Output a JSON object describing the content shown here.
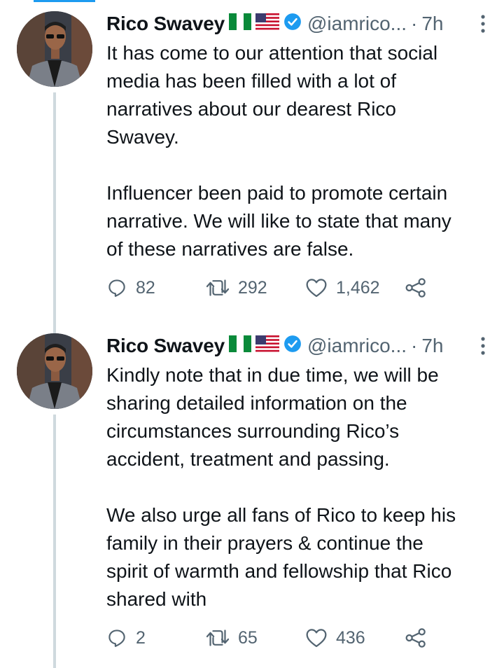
{
  "colors": {
    "accent": "#1d9bf0",
    "secondary_text": "#536471",
    "thread_line": "#cfd9de"
  },
  "tweets": [
    {
      "author_name": "Rico Swavey",
      "flags": [
        "nigeria-flag-icon",
        "usa-flag-icon"
      ],
      "verified": true,
      "handle": "@iamrico...",
      "separator": "·",
      "time": "7h",
      "paragraphs": [
        [
          "It has come to our attention that social",
          "media has been filled with a lot of",
          "narratives about our dearest Rico",
          "Swavey."
        ],
        [
          "Influencer been paid  to promote certain",
          "narrative. We will like to state that many",
          "of these narratives are false."
        ]
      ],
      "replies": "82",
      "retweets": "292",
      "likes": "1,462"
    },
    {
      "author_name": "Rico Swavey",
      "flags": [
        "nigeria-flag-icon",
        "usa-flag-icon"
      ],
      "verified": true,
      "handle": "@iamrico...",
      "separator": "·",
      "time": "7h",
      "paragraphs": [
        [
          "Kindly note that in due time, we will be",
          "sharing detailed information on the",
          "circumstances surrounding Rico’s",
          "accident, treatment and passing."
        ],
        [
          "We also urge all fans of Rico to keep his",
          "family in their prayers & continue the",
          "spirit of warmth and fellowship that Rico",
          "shared with"
        ]
      ],
      "replies": "2",
      "retweets": "65",
      "likes": "436"
    }
  ]
}
